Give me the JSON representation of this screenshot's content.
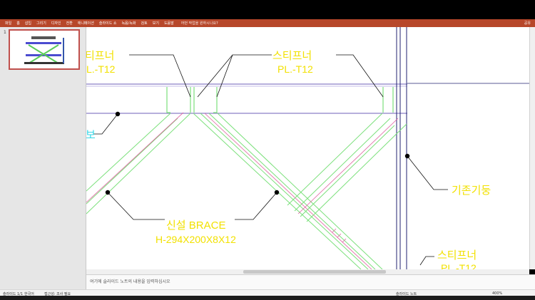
{
  "ribbon": {
    "tabs": [
      "파일",
      "홈",
      "삽입",
      "그리기",
      "디자인",
      "전환",
      "애니메이션",
      "슬라이드 쇼",
      "녹음/녹화",
      "검토",
      "보기",
      "도움말"
    ],
    "tell_me": "어떤 작업을 원하시나요?",
    "share": "공유"
  },
  "thumbs": {
    "slide_number": "1"
  },
  "drawing": {
    "labels": {
      "stiffener_left_title": "티프너",
      "stiffener_left_spec": "L.-T12",
      "stiffener_mid_title": "스티프너",
      "stiffener_mid_spec": "PL.-T12",
      "left_edge_label": "보",
      "existing_column": "기존기둥",
      "brace_title": "신설 BRACE",
      "brace_spec": "H-294X200X8X12",
      "stiffener_br_title": "스티프너",
      "stiffener_br_spec": "PL.-T12"
    }
  },
  "notes": {
    "placeholder": "여기에 슬라이드 노트의 내용을 입력하십시오"
  },
  "status": {
    "slide": "슬라이드 1/1",
    "language": "한국어",
    "accessibility": "접근성: 조사 필요",
    "notes_button": "슬라이드 노트",
    "zoom": "400%"
  },
  "colors": {
    "ribbon": "#b7472a",
    "label_yellow": "#f2e100",
    "brace_green": "#7be07b",
    "beam_purple": "#8a7fc8",
    "left_label_cyan": "#35d8e8",
    "column_navy": "#202070"
  }
}
